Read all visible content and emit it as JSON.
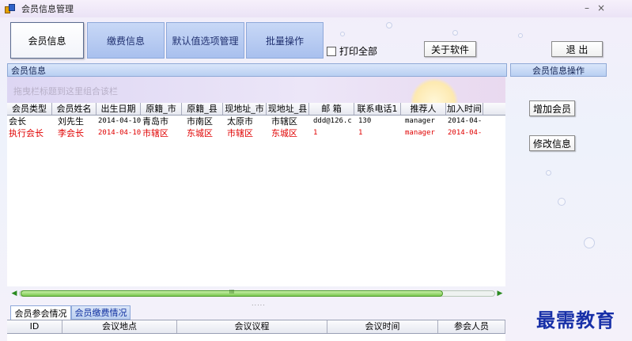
{
  "window": {
    "title": "会员信息管理",
    "minimize": "–",
    "close": "×"
  },
  "main_tabs": [
    {
      "label": "会员信息",
      "active": true
    },
    {
      "label": "缴费信息",
      "active": false
    },
    {
      "label": "默认值选项管理",
      "active": false
    },
    {
      "label": "批量操作",
      "active": false
    }
  ],
  "toolbar": {
    "print_all_label": "打印全部",
    "print_all_checked": false,
    "about_label": "关于软件",
    "exit_label": "退 出"
  },
  "left_section": {
    "title": "会员信息",
    "group_hint": "拖曳栏标题到这里组合该栏"
  },
  "right_section": {
    "title": "会员信息操作",
    "add_label": "增加会员",
    "edit_label": "修改信息"
  },
  "members_table": {
    "columns": [
      "会员类型",
      "会员姓名",
      "出生日期",
      "原籍_市",
      "原籍_县",
      "现地址_市",
      "现地址_县",
      "邮 箱",
      "联系电话1",
      "推荐人",
      "加入时间"
    ],
    "rows": [
      [
        "会长",
        "刘先生",
        "2014-04-10",
        "青岛市",
        "市南区",
        "太原市",
        "市辖区",
        "ddd@126.c",
        "130",
        "manager",
        "2014-04-"
      ],
      [
        "执行会长",
        "李会长",
        "2014-04-10",
        "市辖区",
        "东城区",
        "市辖区",
        "东城区",
        "1",
        "1",
        "manager",
        "2014-04-"
      ]
    ]
  },
  "scrollbar": {
    "grip": "III",
    "splitter": "....."
  },
  "sub_tabs": [
    {
      "label": "会员参会情况",
      "active": true
    },
    {
      "label": "会员缴费情况",
      "active": false
    }
  ],
  "meetings_table": {
    "columns": [
      "ID",
      "会议地点",
      "会议议程",
      "会议时间",
      "参会人员"
    ]
  },
  "watermark": "最需教育"
}
